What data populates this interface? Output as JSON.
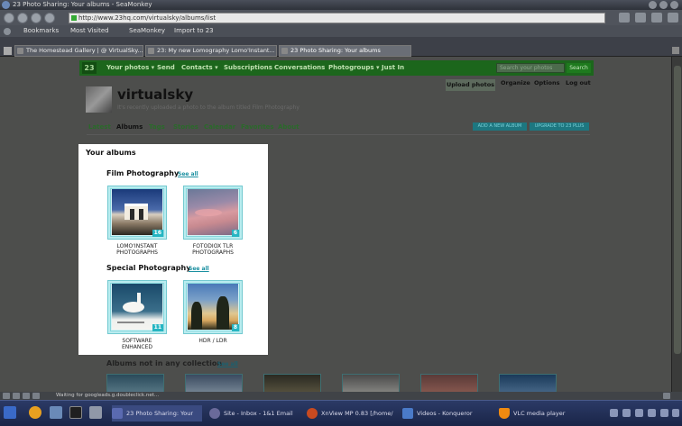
{
  "window": {
    "title": "23 Photo Sharing: Your albums - SeaMonkey"
  },
  "browser": {
    "url": "http://www.23hq.com/virtualsky/albums/list",
    "bookmarks": [
      "Bookmarks",
      "Most Visited",
      "SeaMonkey",
      "Import to 23"
    ],
    "tabs": [
      {
        "label": "The Homestead Gallery | @ VirtualSky..."
      },
      {
        "label": "23: My new Lomography Lomo'Instant..."
      },
      {
        "label": "23 Photo Sharing: Your albums",
        "active": true
      }
    ],
    "status": "Waiting for googleads.g.doubleclick.net..."
  },
  "site": {
    "logo": "23",
    "nav": [
      "Your photos ▾",
      "Send",
      "Contacts ▾",
      "Subscriptions",
      "Conversations",
      "Photogroups ▾",
      "Just In"
    ],
    "search_placeholder": "Search your photos",
    "search_button": "Search"
  },
  "profile": {
    "username": "virtualsky",
    "subline": "It's recently uploaded a photo to the album titled Film Photography",
    "actions": [
      "Upload photos",
      "Organize",
      "Options",
      "Log out"
    ]
  },
  "subnav": {
    "items": [
      "Latest",
      "Albums",
      "Tags",
      "Stories",
      "Calendar",
      "Favorites",
      "About"
    ],
    "active": "Albums",
    "add_album": "ADD A NEW ALBUM",
    "upgrade": "UPGRADE TO 23 PLUS"
  },
  "albums": {
    "heading": "Your albums",
    "collections": [
      {
        "title": "Film Photography",
        "see_all": "See all",
        "items": [
          {
            "label_line1": "LOMO'INSTANT",
            "label_line2": "PHOTOGRAPHS",
            "count": "16"
          },
          {
            "label_line1": "FOTODIOX TLR",
            "label_line2": "PHOTOGRAPHS",
            "count": "6"
          }
        ]
      },
      {
        "title": "Special Photography",
        "see_all": "See all",
        "items": [
          {
            "label_line1": "SOFTWARE",
            "label_line2": "ENHANCED",
            "count": "11"
          },
          {
            "label_line1": "HDR / LDR",
            "label_line2": "",
            "count": "8"
          }
        ]
      }
    ],
    "not_in_collection": "Albums not in any collection",
    "not_in_collection_see_all": "See all"
  },
  "taskbar": {
    "tasks": [
      "23 Photo Sharing: Your",
      "Site - Inbox - 1&1 Email",
      "XnView MP 0.83 [/home/",
      "Videos - Konqueror",
      "VLC media player"
    ]
  },
  "colors": {
    "site_green": "#1c661c",
    "teal": "#26b5c2",
    "panel": "#ffffff"
  }
}
